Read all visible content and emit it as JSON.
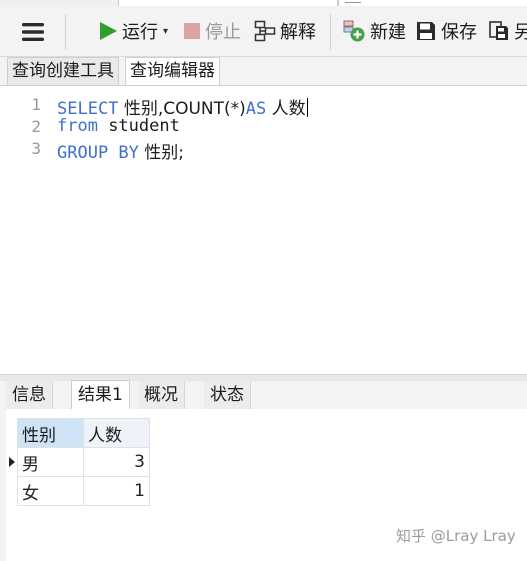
{
  "toolbar": {
    "run_label": "运行",
    "stop_label": "停止",
    "explain_label": "解释",
    "new_label": "新建",
    "save_label": "保存",
    "saveas_label": "另"
  },
  "editor_tabs": [
    "查询创建工具",
    "查询编辑器"
  ],
  "editor": {
    "line_numbers": [
      "1",
      "2",
      "3"
    ],
    "line1": {
      "kw1": "SELECT",
      "t1": " 性别,COUNT(*)",
      "kw2": "AS",
      "t2": " 人数"
    },
    "line2": {
      "kw1": "from",
      "t1": " student"
    },
    "line3": {
      "kw1": "GROUP BY",
      "t1": " 性别;"
    }
  },
  "result_tabs": [
    "信息",
    "结果1",
    "概况",
    "状态"
  ],
  "result": {
    "columns": [
      "性别",
      "人数"
    ],
    "rows": [
      {
        "gender": "男",
        "count": "3"
      },
      {
        "gender": "女",
        "count": "1"
      }
    ]
  },
  "watermark": "知乎 @Lray Lray",
  "colors": {
    "keyword": "#3f6fce",
    "run_icon": "#2e9e2e",
    "stop_icon": "#d9a3a3",
    "new_icon": "#46a046"
  }
}
